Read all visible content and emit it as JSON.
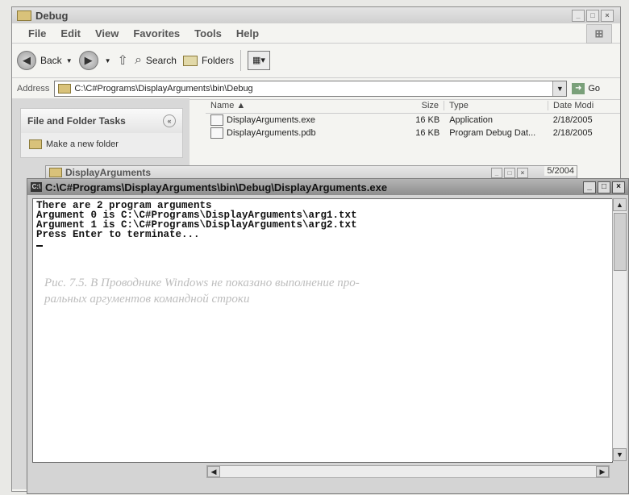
{
  "explorer": {
    "title": "Debug",
    "menu": [
      "File",
      "Edit",
      "View",
      "Favorites",
      "Tools",
      "Help"
    ],
    "toolbar": {
      "back_label": "Back",
      "search_label": "Search",
      "folders_label": "Folders"
    },
    "address": {
      "label": "Address",
      "value": "C:\\C#Programs\\DisplayArguments\\bin\\Debug",
      "go_label": "Go"
    },
    "tasks": {
      "header": "File and Folder Tasks",
      "item": "Make a new folder"
    },
    "columns": {
      "name": "Name",
      "size": "Size",
      "type": "Type",
      "date": "Date Modi"
    },
    "files": [
      {
        "name": "DisplayArguments.exe",
        "size": "16 KB",
        "type": "Application",
        "date": "2/18/2005"
      },
      {
        "name": "DisplayArguments.pdb",
        "size": "16 KB",
        "type": "Program Debug Dat...",
        "date": "2/18/2005"
      }
    ]
  },
  "mini_window": {
    "title": "DisplayArguments",
    "date_fragment": "5/2004"
  },
  "console": {
    "title": "C:\\C#Programs\\DisplayArguments\\bin\\Debug\\DisplayArguments.exe",
    "lines": [
      "There are 2 program arguments",
      "Argument 0 is C:\\C#Programs\\DisplayArguments\\arg1.txt",
      "Argument 1 is C:\\C#Programs\\DisplayArguments\\arg2.txt",
      "Press Enter to terminate..."
    ]
  },
  "bleed_text": [
    "Рис. 7.5. В Проводнике Windows не показано выполнение про-",
    "ральных аргументов командной строки"
  ]
}
